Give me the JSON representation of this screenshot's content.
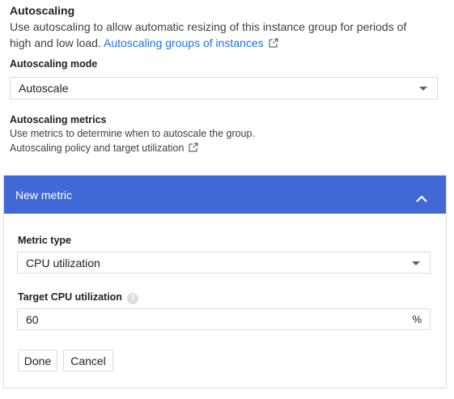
{
  "autoscaling": {
    "title": "Autoscaling",
    "description": "Use autoscaling to allow automatic resizing of this instance group for periods of high and low load.",
    "link_text": "Autoscaling groups of instances"
  },
  "mode": {
    "label": "Autoscaling mode",
    "selected": "Autoscale"
  },
  "metrics": {
    "label": "Autoscaling metrics",
    "description": "Use metrics to determine when to autoscale the group.",
    "link_text": "Autoscaling policy and target utilization"
  },
  "new_metric": {
    "header": "New metric",
    "metric_type_label": "Metric type",
    "metric_type_selected": "CPU utilization",
    "target_label": "Target CPU utilization",
    "target_value": "60",
    "target_unit": "%",
    "done_label": "Done",
    "cancel_label": "Cancel"
  },
  "colors": {
    "header_bg": "#4169d6",
    "link": "#1a73e8",
    "border": "#dadce0"
  },
  "icons": {
    "external_link": "external-link-icon",
    "dropdown": "dropdown-caret-icon",
    "collapse": "chevron-up-icon",
    "help": "help-icon"
  }
}
